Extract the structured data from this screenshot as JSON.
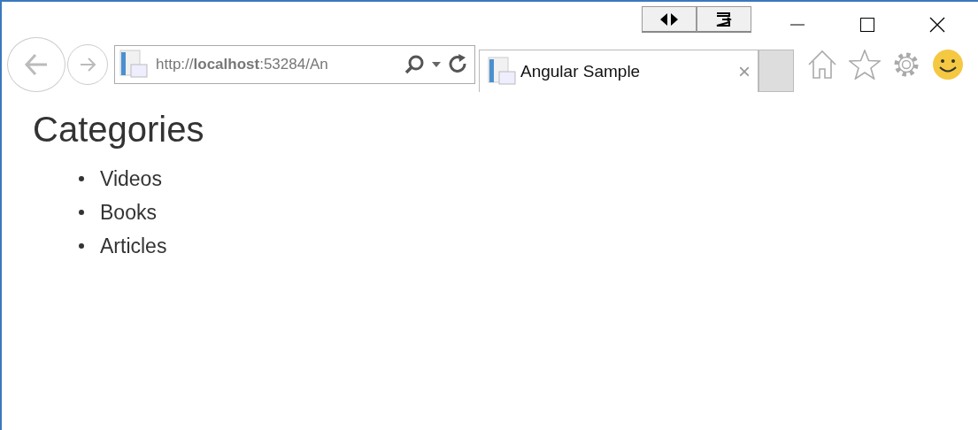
{
  "address_bar": {
    "url": "http://**localhost**:53284/An"
  },
  "tabs": [
    {
      "title": "Angular Sample",
      "selected": true
    }
  ],
  "tab_close": "×",
  "page": {
    "heading": "Categories",
    "items": [
      "Videos",
      "Books",
      "Articles"
    ]
  }
}
